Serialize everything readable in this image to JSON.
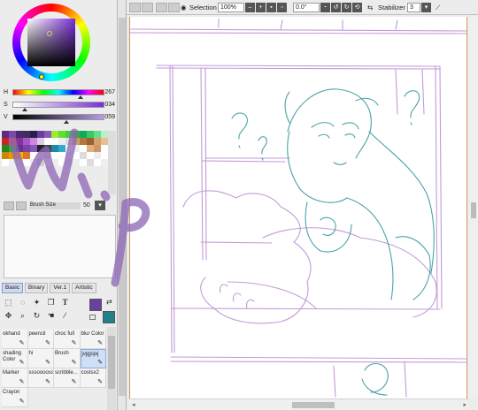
{
  "sliders": [
    {
      "label": "H",
      "value": "267",
      "thumb_fraction": 0.74
    },
    {
      "label": "S",
      "value": "034",
      "thumb_fraction": 0.13
    },
    {
      "label": "V",
      "value": "059",
      "thumb_fraction": 0.59
    }
  ],
  "brush_size": {
    "label": "Brush Size",
    "value": "50"
  },
  "tool_tabs": [
    {
      "label": "Basic",
      "active": true
    },
    {
      "label": "Binary",
      "active": false
    },
    {
      "label": "Ver.1",
      "active": false
    },
    {
      "label": "Artistic",
      "active": false
    }
  ],
  "tools": {
    "text_tool_glyph": "T"
  },
  "brushes": [
    {
      "name": "okhand",
      "selected": false
    },
    {
      "name": "peencil",
      "selected": false
    },
    {
      "name": "choc full",
      "selected": false
    },
    {
      "name": "blur Color",
      "selected": false
    },
    {
      "name": "shading Color",
      "selected": false
    },
    {
      "name": "hi",
      "selected": false
    },
    {
      "name": "Brush",
      "selected": false
    },
    {
      "name": "jvjgjsjxj",
      "selected": true
    },
    {
      "name": "Marker",
      "selected": false
    },
    {
      "name": "sssooooss",
      "selected": false
    },
    {
      "name": "scribble...",
      "selected": false
    },
    {
      "name": "costsx2",
      "selected": false
    },
    {
      "name": "Crayon",
      "selected": false
    }
  ],
  "toolbar": {
    "selection_label": "Selection",
    "zoom": "100%",
    "rotation": "0.0°",
    "stabilizer_label": "Stabilizer",
    "stabilizer_value": "3"
  },
  "overlay_text": "W.I.P",
  "colors": {
    "foreground": "#6b3fa0",
    "background": "#20808c",
    "sketch_purple": "#c49ad8",
    "sketch_teal": "#4aa3a8",
    "wip_purple": "#8c64b4"
  },
  "swatch_colors": [
    "#5a2d82",
    "#7a4aa8",
    "#4d2a6e",
    "#3b2f5c",
    "#2b1d4a",
    "#6e3d9b",
    "#8a5ab8",
    "#99ee33",
    "#66dd33",
    "#44cc44",
    "#22bb33",
    "#11aa55",
    "#33cc66",
    "#66dd88",
    "#bbeecc",
    "#cc2222",
    "#dd4444",
    "#883399",
    "#aa55cc",
    "#cc88dd",
    "#e0c8e8",
    "#ffffff",
    "#ffffff",
    "#eeeeee",
    "#dddddd",
    "#c8a060",
    "#b07840",
    "#9a6030",
    "#d4a070",
    "#e8c090",
    "#228822",
    "#33aa33",
    "#663388",
    "#7744aa",
    "#8855bb",
    "#222222",
    "#444444",
    "#2288aa",
    "#33aacc",
    "#ffffff",
    "#eeeeee",
    "#ffffff",
    "#e0b080",
    "#cc9966",
    "#ffffff",
    "#cc8800",
    "#ee9900",
    "#ffaa00",
    "#dd7722",
    "#ffffff",
    "#eeeeee",
    "#dddddd",
    "#ffffff",
    "#ffffff",
    "#eeeeee",
    "#ffffff",
    "#dddddd",
    "#ffffff",
    "#eeeeee",
    "#ffffff",
    "#ffffff",
    "#eeeeee",
    "#dddddd",
    "#ffffff",
    "#eeeeee",
    "#cccccc",
    "#ffffff",
    "#eeeeee",
    "#ffffff",
    "#dddddd",
    "#eeeeee",
    "#ffffff",
    "#dddddd",
    "#ffffff",
    "#eeeeee"
  ]
}
